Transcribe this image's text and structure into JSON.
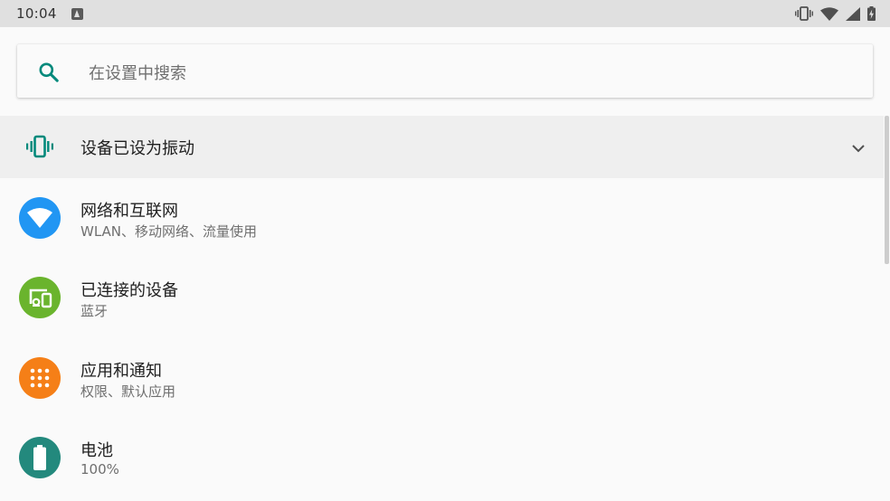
{
  "status_bar": {
    "time": "10:04"
  },
  "search": {
    "placeholder": "在设置中搜索"
  },
  "suggestion": {
    "title": "设备已设为振动"
  },
  "items": [
    {
      "title": "网络和互联网",
      "summary": "WLAN、移动网络、流量使用",
      "icon": "wifi-icon",
      "color": "#2196f3"
    },
    {
      "title": "已连接的设备",
      "summary": "蓝牙",
      "icon": "connected-devices-icon",
      "color": "#6ab42d"
    },
    {
      "title": "应用和通知",
      "summary": "权限、默认应用",
      "icon": "apps-icon",
      "color": "#f57f17"
    },
    {
      "title": "电池",
      "summary": "100%",
      "icon": "battery-icon",
      "color": "#23897d"
    }
  ],
  "colors": {
    "accent": "#00897b",
    "status_bar_bg": "#e0e0e0",
    "suggestion_bg": "#efefef"
  }
}
